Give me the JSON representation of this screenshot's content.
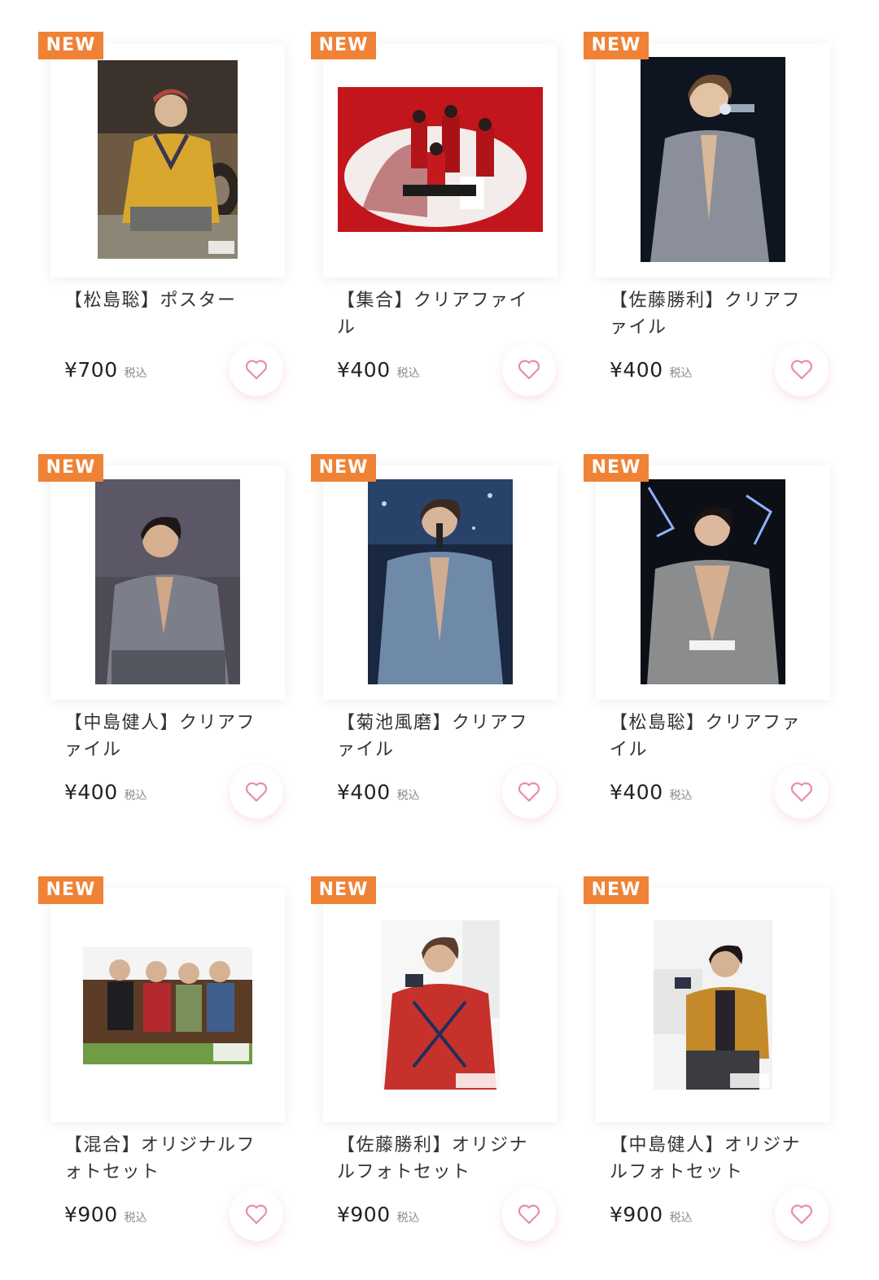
{
  "products": [
    {
      "badge": "NEW",
      "title": "【松島聡】ポスター",
      "price": "¥700",
      "tax": "税込",
      "image": "poster-matsushima",
      "favorite_icon": "heart-outline-icon"
    },
    {
      "badge": "NEW",
      "title": "【集合】クリアファイル",
      "price": "¥400",
      "tax": "税込",
      "image": "clearfile-group",
      "favorite_icon": "heart-outline-icon"
    },
    {
      "badge": "NEW",
      "title": "【佐藤勝利】クリアファイル",
      "price": "¥400",
      "tax": "税込",
      "image": "clearfile-sato",
      "favorite_icon": "heart-outline-icon"
    },
    {
      "badge": "NEW",
      "title": "【中島健人】クリアファイル",
      "price": "¥400",
      "tax": "税込",
      "image": "clearfile-nakajima",
      "favorite_icon": "heart-outline-icon"
    },
    {
      "badge": "NEW",
      "title": "【菊池風磨】クリアファイル",
      "price": "¥400",
      "tax": "税込",
      "image": "clearfile-kikuchi",
      "favorite_icon": "heart-outline-icon"
    },
    {
      "badge": "NEW",
      "title": "【松島聡】クリアファイル",
      "price": "¥400",
      "tax": "税込",
      "image": "clearfile-matsushima",
      "favorite_icon": "heart-outline-icon"
    },
    {
      "badge": "NEW",
      "title": "【混合】オリジナルフォトセット",
      "price": "¥900",
      "tax": "税込",
      "image": "photoset-mixed",
      "favorite_icon": "heart-outline-icon"
    },
    {
      "badge": "NEW",
      "title": "【佐藤勝利】オリジナルフォトセット",
      "price": "¥900",
      "tax": "税込",
      "image": "photoset-sato",
      "favorite_icon": "heart-outline-icon"
    },
    {
      "badge": "NEW",
      "title": "【中島健人】オリジナルフォトセット",
      "price": "¥900",
      "tax": "税込",
      "image": "photoset-nakajima",
      "favorite_icon": "heart-outline-icon"
    }
  ],
  "colors": {
    "badge": "#f08236",
    "heart": "#e98bb0",
    "price": "#222222"
  }
}
